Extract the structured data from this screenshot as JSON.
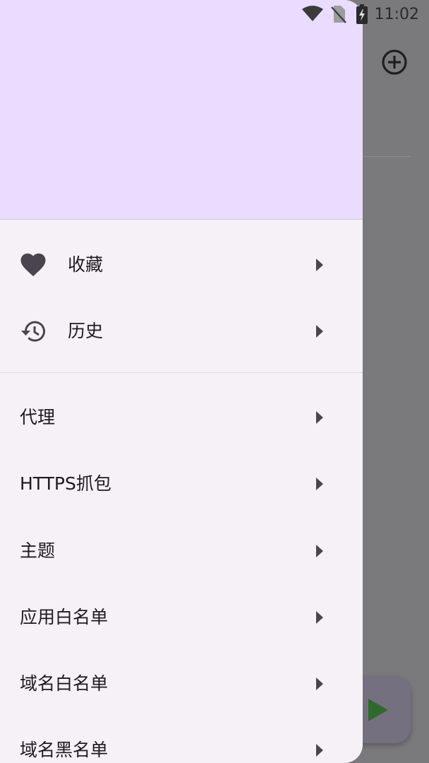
{
  "status_bar": {
    "time": "11:02",
    "icons": [
      "wifi-icon",
      "no-sim-icon",
      "battery-charging-icon"
    ]
  },
  "background_app": {
    "add_icon": "add-circle-icon",
    "fab_icon": "play-icon",
    "fab_color": "#2e6b2a"
  },
  "drawer": {
    "header_color": "#eadcfe",
    "surface_color": "#f6f1f7",
    "primary_items": [
      {
        "label": "收藏",
        "icon": "heart-icon"
      },
      {
        "label": "历史",
        "icon": "history-icon"
      }
    ],
    "settings_items": [
      {
        "label": "代理"
      },
      {
        "label": "HTTPS抓包"
      },
      {
        "label": "主题"
      },
      {
        "label": "应用白名单"
      },
      {
        "label": "域名白名单"
      },
      {
        "label": "域名黑名单"
      }
    ]
  }
}
